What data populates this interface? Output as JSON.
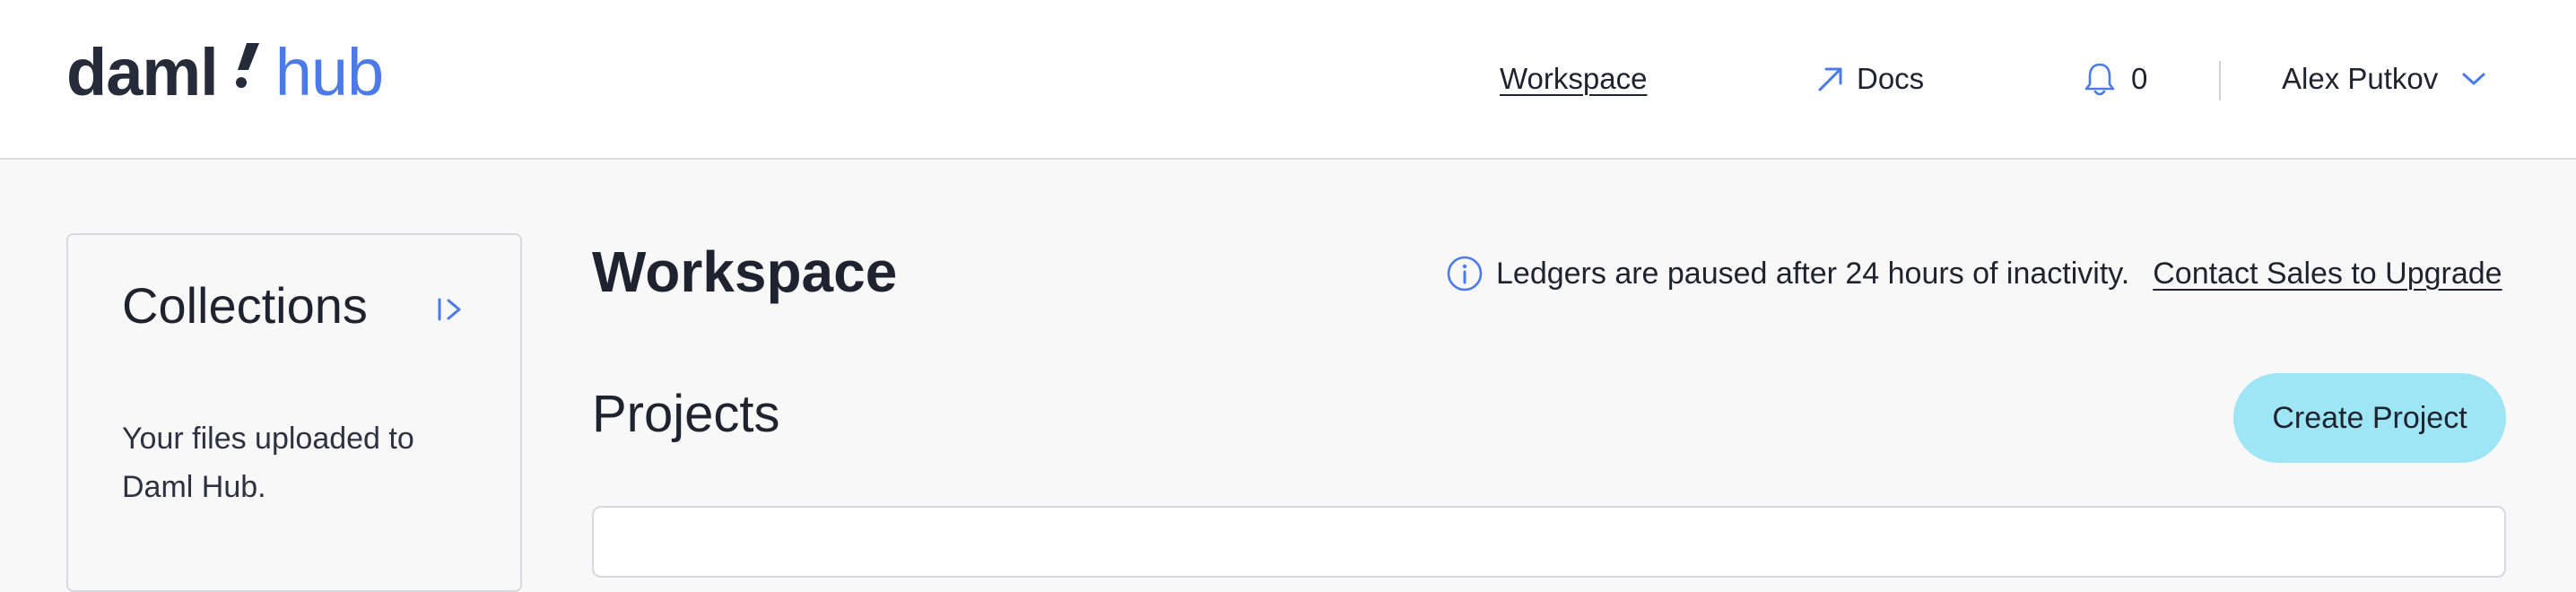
{
  "header": {
    "logo": {
      "left": "daml",
      "right": "hub"
    },
    "nav": {
      "workspace": "Workspace",
      "docs": "Docs",
      "notifications_count": "0",
      "user_name": "Alex Putkov"
    }
  },
  "sidebar": {
    "title": "Collections",
    "description": "Your files uploaded to Daml Hub."
  },
  "main": {
    "title": "Workspace",
    "notice": {
      "text": "Ledgers are paused after 24 hours of inactivity.",
      "link": "Contact Sales to Upgrade"
    },
    "projects": {
      "title": "Projects",
      "create_button": "Create Project"
    }
  },
  "colors": {
    "brand_dark": "#262b3a",
    "brand_blue": "#4c7ae6",
    "button_bg": "#9ee6f5",
    "page_bg": "#f8f8f8"
  },
  "icons": {
    "docs": "external-link-arrow-icon",
    "notifications": "bell-icon",
    "user_menu": "chevron-down-icon",
    "notice": "info-icon",
    "sidebar_toggle": "expand-sidebar-icon"
  }
}
